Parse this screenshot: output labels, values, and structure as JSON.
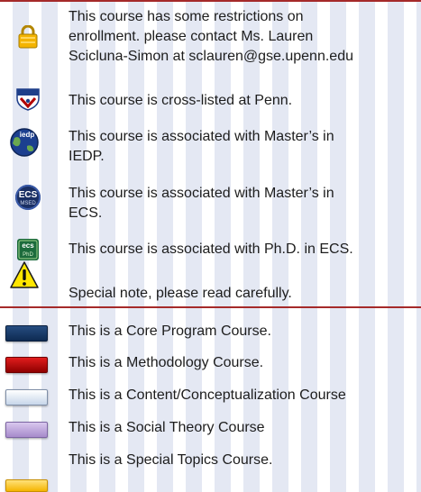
{
  "icon_legend": [
    {
      "icon": "lock-icon",
      "text_lines": [
        "This course has some restrictions on",
        "enrollment. please contact Ms. Lauren",
        "Scicluna-Simon at sclauren@gse.upenn.edu"
      ]
    },
    {
      "icon": "penn-shield-icon",
      "text_lines": [
        "This course is cross-listed at Penn."
      ]
    },
    {
      "icon": "iedp-globe-icon",
      "text_lines": [
        "This course is associated with Master’s in",
        "IEDP."
      ]
    },
    {
      "icon": "ecs-msed-icon",
      "text_lines": [
        "This course is associated with Master’s in",
        "ECS."
      ]
    },
    {
      "icon": "ecs-phd-icon",
      "text_lines": [
        "This course is associated with Ph.D. in ECS."
      ]
    },
    {
      "icon": "warning-icon",
      "text_lines": [
        "Special note, please read carefully."
      ]
    }
  ],
  "icon_badges": {
    "iedp": "iedp",
    "ecs_top": "ECS",
    "ecs_sub": "MSED",
    "ecs_phd": "ecs",
    "ecs_phd_sub": "PhD"
  },
  "color_legend": [
    {
      "swatch": "core",
      "color": "#17365d",
      "text": "This  is a Core Program Course."
    },
    {
      "swatch": "method",
      "color": "#c00000",
      "text": "This is a Methodology Course."
    },
    {
      "swatch": "content",
      "color": "#dbe5f1",
      "text": "This is a Content/Conceptualization Course"
    },
    {
      "swatch": "social",
      "color": "#b8a4d8",
      "text": "This is a Social Theory Course"
    },
    {
      "swatch": "special",
      "color": "#ffc000",
      "text": "This is a Special Topics Course."
    }
  ],
  "rule_color": "#a52a2a"
}
